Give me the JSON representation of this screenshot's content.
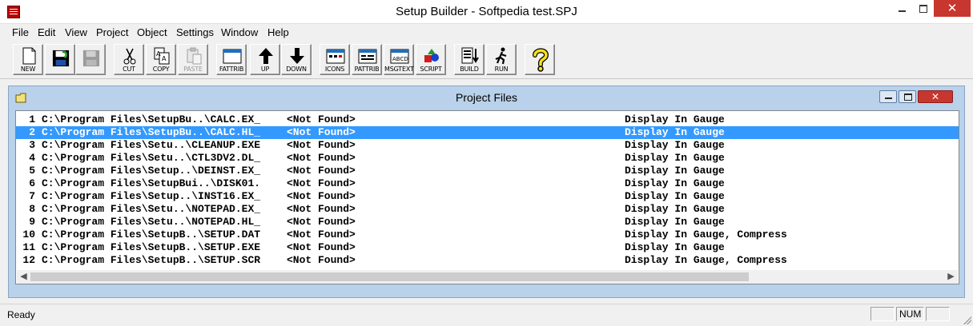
{
  "window": {
    "title": "Setup Builder - Softpedia test.SPJ",
    "minimize": "—",
    "maximize": "☐",
    "close": "✕"
  },
  "menu": [
    "File",
    "Edit",
    "View",
    "Project",
    "Object",
    "Settings",
    "Window",
    "Help"
  ],
  "toolbar": {
    "new": "NEW",
    "save": "",
    "save_all": "",
    "cut": "CUT",
    "copy": "COPY",
    "paste": "PASTE",
    "fattrib": "FATTRIB",
    "up": "UP",
    "down": "DOWN",
    "icons": "ICONS",
    "pattrib": "PATTRIB",
    "msgtext": "MSGTEXT",
    "script": "SCRIPT",
    "build": "BUILD",
    "run": "RUN",
    "help": ""
  },
  "child_window": {
    "title": "Project Files",
    "close": "✕"
  },
  "files": [
    {
      "num": "1",
      "path": "C:\\Program Files\\SetupBu..\\CALC.EX_",
      "status": "<Not Found>",
      "attributes": "Display In Gauge"
    },
    {
      "num": "2",
      "path": "C:\\Program Files\\SetupBu..\\CALC.HL_",
      "status": "<Not Found>",
      "attributes": "Display In Gauge"
    },
    {
      "num": "3",
      "path": "C:\\Program Files\\Setu..\\CLEANUP.EXE",
      "status": "<Not Found>",
      "attributes": "Display In Gauge"
    },
    {
      "num": "4",
      "path": "C:\\Program Files\\Setu..\\CTL3DV2.DL_",
      "status": "<Not Found>",
      "attributes": "Display In Gauge"
    },
    {
      "num": "5",
      "path": "C:\\Program Files\\Setup..\\DEINST.EX_",
      "status": "<Not Found>",
      "attributes": "Display In Gauge"
    },
    {
      "num": "6",
      "path": "C:\\Program Files\\SetupBui..\\DISK01.",
      "status": "<Not Found>",
      "attributes": "Display In Gauge"
    },
    {
      "num": "7",
      "path": "C:\\Program Files\\Setup..\\INST16.EX_",
      "status": "<Not Found>",
      "attributes": "Display In Gauge"
    },
    {
      "num": "8",
      "path": "C:\\Program Files\\Setu..\\NOTEPAD.EX_",
      "status": "<Not Found>",
      "attributes": "Display In Gauge"
    },
    {
      "num": "9",
      "path": "C:\\Program Files\\Setu..\\NOTEPAD.HL_",
      "status": "<Not Found>",
      "attributes": "Display In Gauge"
    },
    {
      "num": "10",
      "path": "C:\\Program Files\\SetupB..\\SETUP.DAT",
      "status": "<Not Found>",
      "attributes": "Display In Gauge, Compress"
    },
    {
      "num": "11",
      "path": "C:\\Program Files\\SetupB..\\SETUP.EXE",
      "status": "<Not Found>",
      "attributes": "Display In Gauge"
    },
    {
      "num": "12",
      "path": "C:\\Program Files\\SetupB..\\SETUP.SCR",
      "status": "<Not Found>",
      "attributes": "Display In Gauge, Compress"
    }
  ],
  "selected_row_index": 1,
  "scrollbar": {
    "left_arrow": "◀",
    "right_arrow": "▶"
  },
  "status": {
    "text": "Ready",
    "pane1": "",
    "pane2": "NUM",
    "pane3": ""
  },
  "colors": {
    "selection": "#3399ff",
    "child_frame": "#b9d1ea",
    "close_button": "#c7372f"
  }
}
